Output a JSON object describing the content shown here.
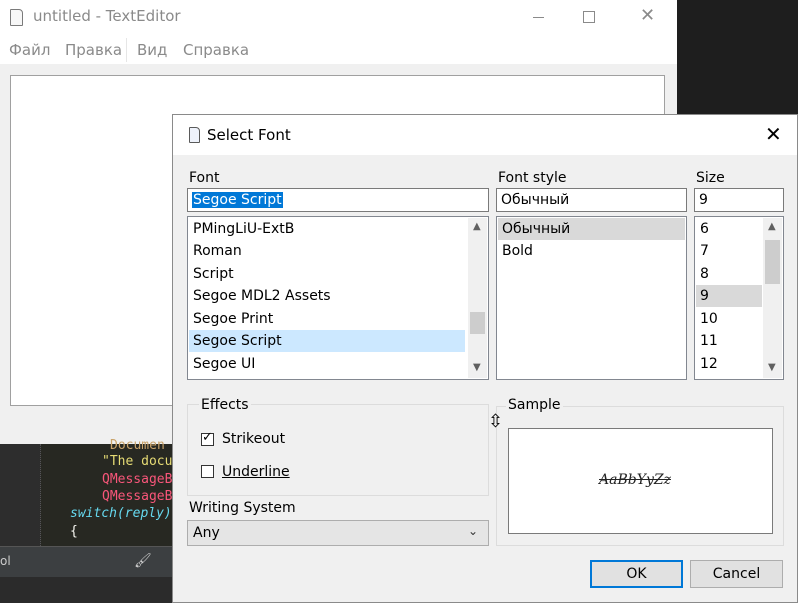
{
  "editor": {
    "title": "untitled - TextEditor",
    "menu": [
      "Файл",
      "Правка",
      "Вид",
      "Справка"
    ]
  },
  "code_peek": {
    "lines": [
      "Documen",
      "\"The docu",
      "QMessageB",
      "QMessageB",
      "switch(reply)",
      "{"
    ],
    "status_label": "ol"
  },
  "dialog": {
    "title": "Select Font",
    "font_label": "Font",
    "font_value": "Segoe Script",
    "font_list": [
      "PMingLiU-ExtB",
      "Roman",
      "Script",
      "Segoe MDL2 Assets",
      "Segoe Print",
      "Segoe Script",
      "Segoe UI"
    ],
    "font_selected_index": 5,
    "style_label": "Font style",
    "style_value": "Обычный",
    "style_list": [
      "Обычный",
      "Bold"
    ],
    "style_selected_index": 0,
    "size_label": "Size",
    "size_value": "9",
    "size_list": [
      "6",
      "7",
      "8",
      "9",
      "10",
      "11",
      "12"
    ],
    "size_selected_index": 3,
    "effects_label": "Effects",
    "strikeout_label": "Strikeout",
    "strikeout_checked": true,
    "underline_label": "Underline",
    "underline_checked": false,
    "writing_system_label": "Writing System",
    "writing_system_value": "Any",
    "sample_label": "Sample",
    "sample_text": "AaBbYyZz",
    "ok_label": "OK",
    "cancel_label": "Cancel"
  },
  "icons": {
    "editor_app": "document-icon",
    "dialog_app": "document-icon",
    "status_tool": "brush-icon"
  }
}
